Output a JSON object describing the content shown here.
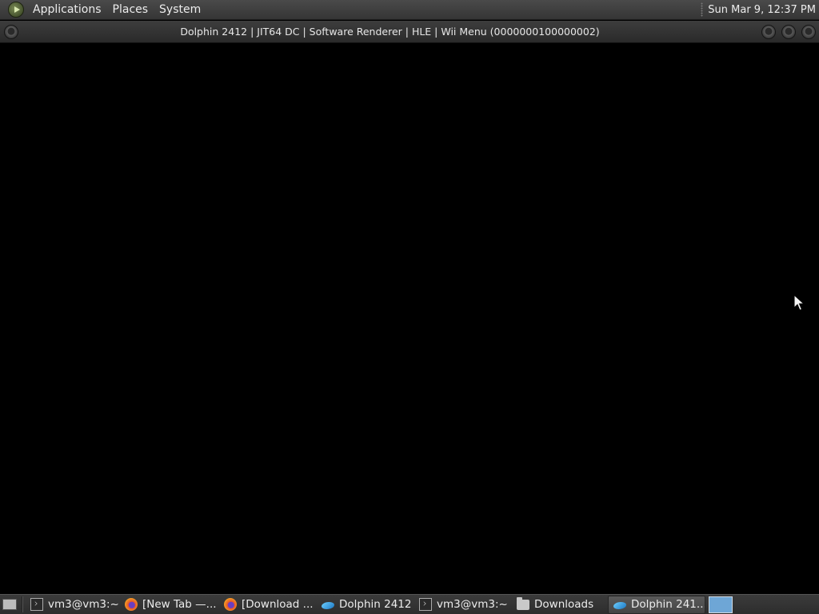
{
  "top_panel": {
    "menu": [
      {
        "label": "Applications"
      },
      {
        "label": "Places"
      },
      {
        "label": "System"
      }
    ],
    "clock": "Sun Mar  9, 12:37 PM"
  },
  "window": {
    "title": "Dolphin 2412 | JIT64 DC | Software Renderer | HLE | Wii Menu (0000000100000002)"
  },
  "taskbar": {
    "tasks": [
      {
        "label": "vm3@vm3:~",
        "icon": "terminal-icon",
        "active": false
      },
      {
        "label": "[New Tab —...",
        "icon": "firefox-icon",
        "active": false
      },
      {
        "label": "[Download ...",
        "icon": "firefox-icon",
        "active": false
      },
      {
        "label": "Dolphin 2412",
        "icon": "dolphin-icon",
        "active": false
      },
      {
        "label": "vm3@vm3:~",
        "icon": "terminal-icon",
        "active": false
      },
      {
        "label": "Downloads",
        "icon": "folder-icon",
        "active": false
      },
      {
        "label": "Dolphin 241...",
        "icon": "dolphin-icon",
        "active": true
      }
    ]
  },
  "colors": {
    "panel": "#3a3a3a",
    "render_background": "#000000",
    "workspace_active": "#6ea6d6"
  }
}
